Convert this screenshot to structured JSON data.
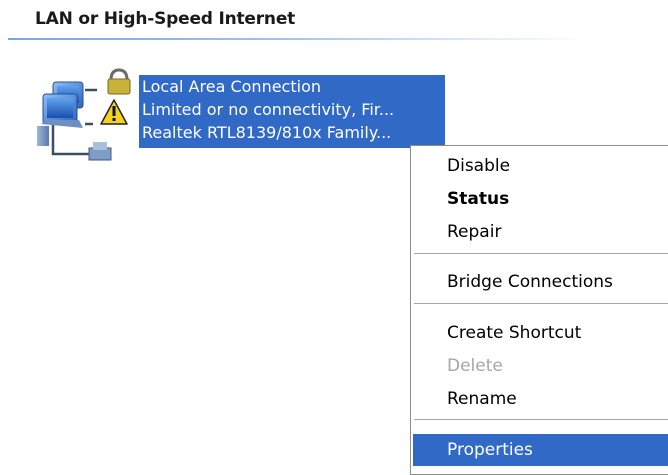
{
  "group": {
    "title": "LAN or High-Speed Internet"
  },
  "connection": {
    "name": "Local Area Connection",
    "status": "Limited or no connectivity, Fir...",
    "device": "Realtek RTL8139/810x Family..."
  },
  "context_menu": {
    "items": [
      {
        "label": "Disable",
        "state": "normal"
      },
      {
        "label": "Status",
        "state": "default"
      },
      {
        "label": "Repair",
        "state": "normal"
      },
      {
        "label": "Bridge Connections",
        "state": "normal"
      },
      {
        "label": "Create Shortcut",
        "state": "normal"
      },
      {
        "label": "Delete",
        "state": "disabled"
      },
      {
        "label": "Rename",
        "state": "normal"
      },
      {
        "label": "Properties",
        "state": "highlighted"
      }
    ]
  },
  "colors": {
    "selection": "#3169c6",
    "disabled_text": "#a7a6aa",
    "header_rule": "#7aa6e8"
  },
  "icons": {
    "connection": "network-connection-icon",
    "warning": "warning-icon",
    "lock": "lock-icon"
  }
}
